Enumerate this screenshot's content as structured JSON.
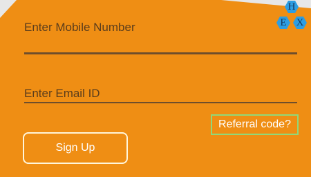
{
  "form": {
    "mobile_label": "Enter Mobile Number",
    "email_label": "Enter Email ID",
    "referral_label": "Referral code?",
    "signup_label": "Sign Up"
  },
  "logo": {
    "letters": [
      "H",
      "E",
      "X"
    ]
  },
  "colors": {
    "background": "#ef8e14",
    "underline": "#6e4e2c",
    "label_text": "#5b3d1c",
    "referral_border": "#8fd97a",
    "logo_hex": "#2d9ee3"
  }
}
